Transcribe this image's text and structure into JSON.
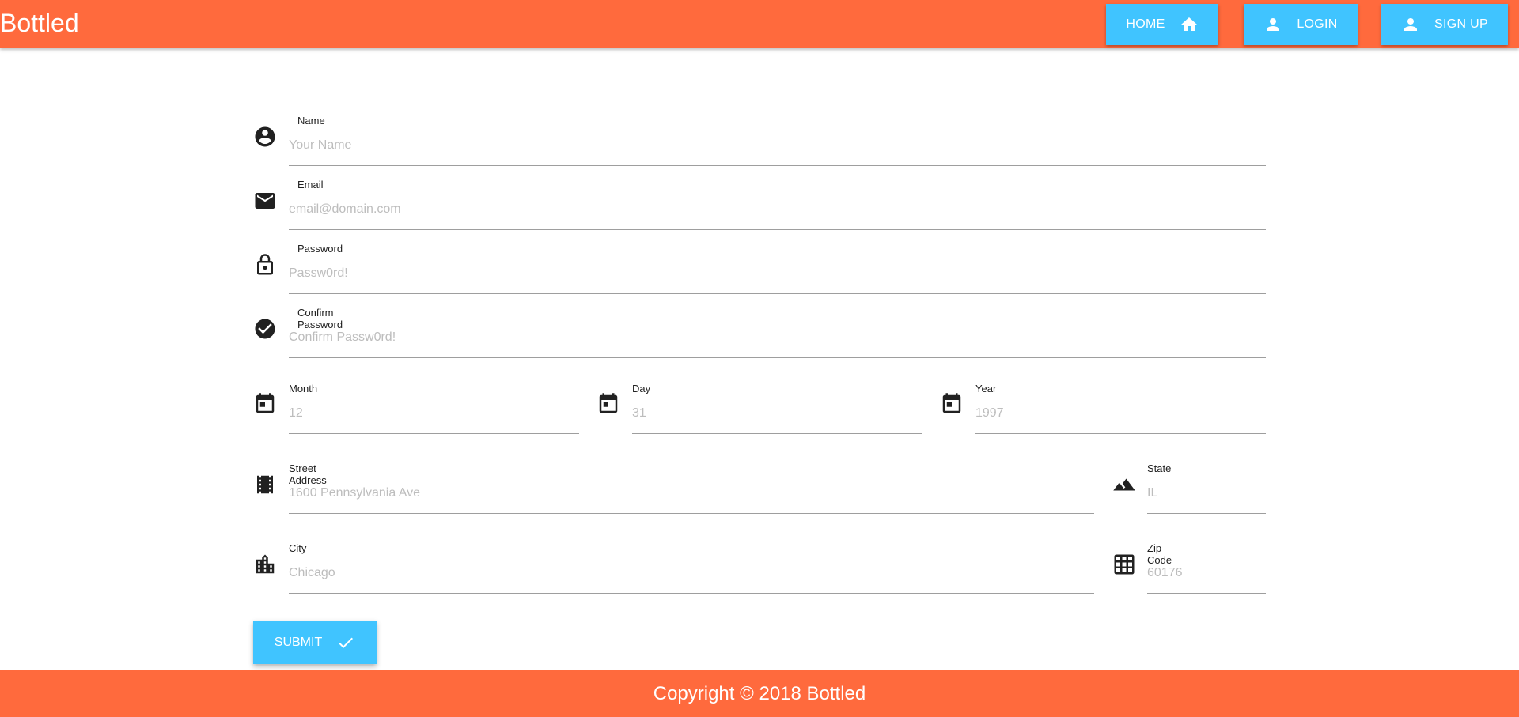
{
  "header": {
    "brand": "Bottled",
    "nav": {
      "home": "HOME",
      "login": "LOGIN",
      "signup": "SIGN UP"
    }
  },
  "form": {
    "name": {
      "label": "Name",
      "placeholder": "Your Name",
      "icon": "account-circle-icon"
    },
    "email": {
      "label": "Email",
      "placeholder": "email@domain.com",
      "icon": "mail-icon"
    },
    "password": {
      "label": "Password",
      "placeholder": "Passw0rd!",
      "icon": "lock-icon"
    },
    "confirm_password": {
      "label": "Confirm Password",
      "placeholder": "Confirm Passw0rd!",
      "icon": "check-circle-icon"
    },
    "month": {
      "label": "Month",
      "placeholder": "12",
      "icon": "calendar-icon"
    },
    "day": {
      "label": "Day",
      "placeholder": "31",
      "icon": "calendar-icon"
    },
    "year": {
      "label": "Year",
      "placeholder": "1997",
      "icon": "calendar-icon"
    },
    "street": {
      "label": "Street Address",
      "placeholder": "1600 Pennsylvania Ave",
      "icon": "film-strip-icon"
    },
    "state": {
      "label": "State",
      "placeholder": "IL",
      "icon": "terrain-icon"
    },
    "city": {
      "label": "City",
      "placeholder": "Chicago",
      "icon": "city-icon"
    },
    "zip": {
      "label": "Zip Code",
      "placeholder": "60176",
      "icon": "grid-icon"
    },
    "submit": "SUBMIT"
  },
  "footer": {
    "text": "Copyright © 2018 Bottled"
  },
  "colors": {
    "primary": "#ff6a3d",
    "accent": "#40c4ff"
  }
}
